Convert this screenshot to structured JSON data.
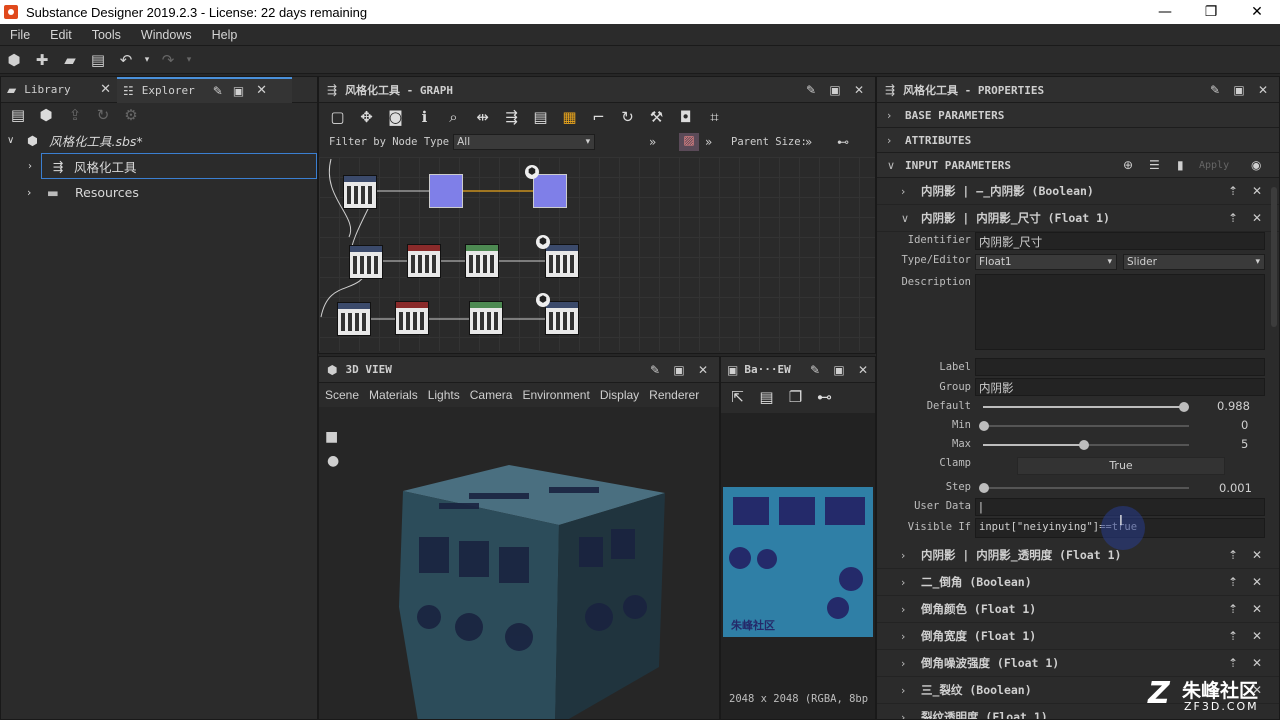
{
  "window": {
    "title": "Substance Designer 2019.2.3 - License: 22 days remaining",
    "min": "—",
    "restore": "❐",
    "close": "✕"
  },
  "menu": [
    "File",
    "Edit",
    "Tools",
    "Windows",
    "Help"
  ],
  "library_panel": {
    "tabs": [
      {
        "label": "Library"
      },
      {
        "label": "Explorer"
      }
    ],
    "package": "风格化工具.sbs*",
    "graph_item": "风格化工具",
    "resources": "Resources"
  },
  "graph_panel": {
    "title": "风格化工具 - GRAPH",
    "filter_label": "Filter by Node Type",
    "filter_value": "All",
    "parent_size": "Parent Size:"
  },
  "view3d": {
    "title": "3D VIEW",
    "menu": [
      "Scene",
      "Materials",
      "Lights",
      "Camera",
      "Environment",
      "Display",
      "Renderer"
    ]
  },
  "view2d": {
    "title": "Ba···EW",
    "status": "2048 x 2048 (RGBA, 8bp",
    "watermark_text": "朱峰社区"
  },
  "properties": {
    "title": "风格化工具 - PROPERTIES",
    "sections": [
      "BASE PARAMETERS",
      "ATTRIBUTES",
      "INPUT PARAMETERS"
    ],
    "apply": "Apply",
    "params_top": [
      "内阴影 | —_内阴影 (Boolean)",
      "内阴影 | 内阴影_尺寸 (Float 1)"
    ],
    "fields": {
      "identifier_label": "Identifier",
      "identifier": "内阴影_尺寸",
      "type_label": "Type/Editor",
      "type": "Float1",
      "editor": "Slider",
      "description_label": "Description",
      "label_label": "Label",
      "label": "",
      "group_label": "Group",
      "group": "内阴影",
      "default_label": "Default",
      "default": "0.988",
      "min_label": "Min",
      "min": "0",
      "max_label": "Max",
      "max": "5",
      "clamp_label": "Clamp",
      "clamp": "True",
      "step_label": "Step",
      "step": "0.001",
      "userdata_label": "User Data",
      "userdata": "|",
      "visibleif_label": "Visible If",
      "visibleif": "input[\"neiyinying\"]==true"
    },
    "params_bottom": [
      "内阴影 | 内阴影_透明度 (Float 1)",
      "二_倒角 (Boolean)",
      "倒角颜色 (Float 1)",
      "倒角宽度 (Float 1)",
      "倒角噪波强度 (Float 1)",
      "三_裂纹 (Boolean)",
      "裂纹透明度 (Float 1)"
    ]
  },
  "watermark": {
    "brand": "朱峰社区",
    "site": "ZF3D.COM"
  }
}
